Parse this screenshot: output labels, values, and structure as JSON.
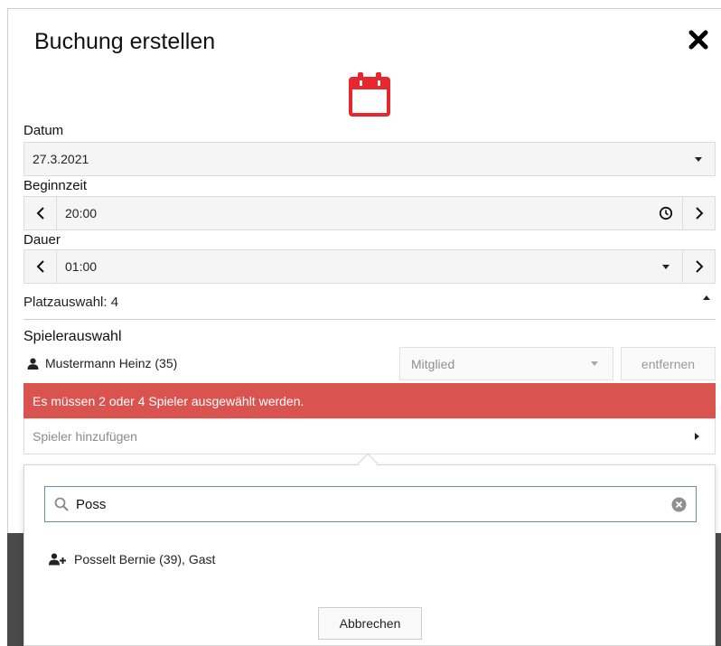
{
  "dialog": {
    "title": "Buchung erstellen"
  },
  "colors": {
    "accent": "#e8262d",
    "error": "#d9534f"
  },
  "icons": {
    "close": "close-icon",
    "header": "calendar-icon",
    "time": "clock-icon",
    "player": "user-icon",
    "add_user": "user-plus-icon",
    "search": "search-icon",
    "clear": "clear-icon"
  },
  "datum": {
    "label": "Datum",
    "value": "27.3.2021"
  },
  "beginnzeit": {
    "label": "Beginnzeit",
    "value": "20:00"
  },
  "dauer": {
    "label": "Dauer",
    "value": "01:00"
  },
  "platzauswahl": {
    "label": "Platzauswahl: 4"
  },
  "spielerauswahl": {
    "label": "Spielerauswahl",
    "players": [
      {
        "name": "Mustermann Heinz (35)",
        "role": "Mitglied",
        "remove_label": "entfernen"
      }
    ],
    "error": "Es müssen 2 oder 4 Spieler ausgewählt werden.",
    "add_placeholder": "Spieler hinzufügen"
  },
  "search_popup": {
    "query": "Poss",
    "results": [
      {
        "label": "Posselt Bernie (39), Gast"
      }
    ],
    "cancel_label": "Abbrechen"
  }
}
